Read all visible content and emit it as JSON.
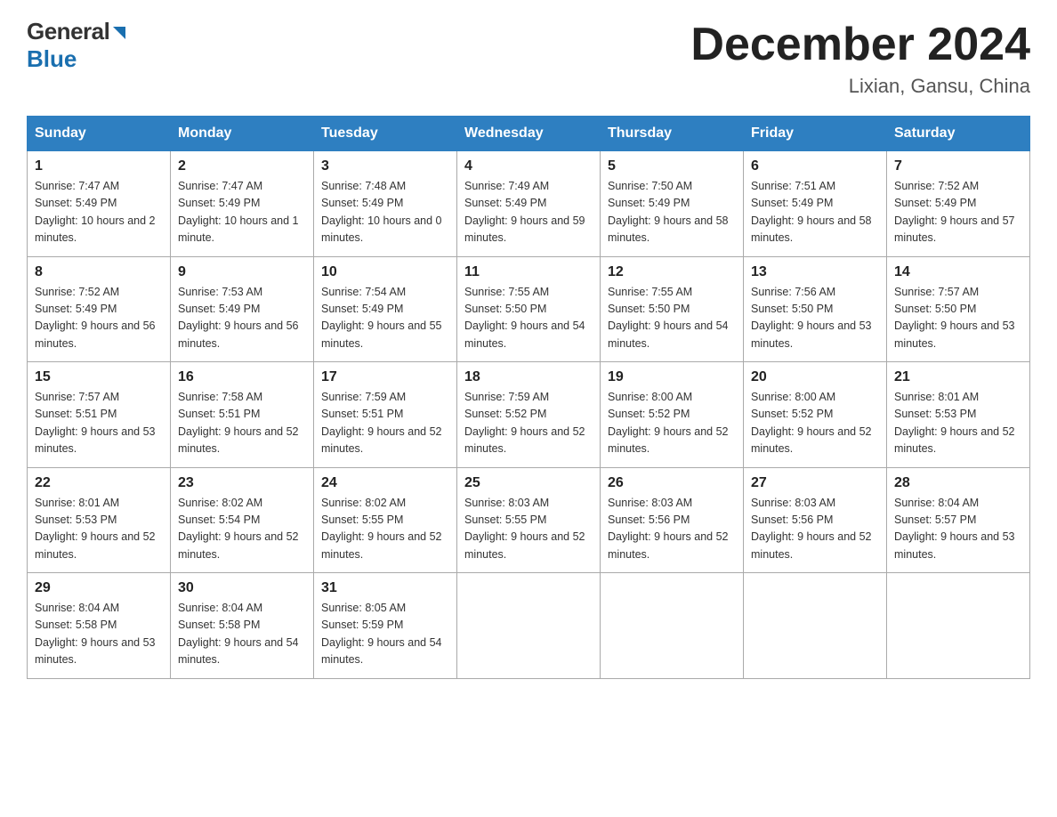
{
  "header": {
    "logo_general": "General",
    "logo_blue": "Blue",
    "month_title": "December 2024",
    "location": "Lixian, Gansu, China"
  },
  "days_of_week": [
    "Sunday",
    "Monday",
    "Tuesday",
    "Wednesday",
    "Thursday",
    "Friday",
    "Saturday"
  ],
  "weeks": [
    [
      {
        "day": "1",
        "sunrise": "7:47 AM",
        "sunset": "5:49 PM",
        "daylight": "10 hours and 2 minutes."
      },
      {
        "day": "2",
        "sunrise": "7:47 AM",
        "sunset": "5:49 PM",
        "daylight": "10 hours and 1 minute."
      },
      {
        "day": "3",
        "sunrise": "7:48 AM",
        "sunset": "5:49 PM",
        "daylight": "10 hours and 0 minutes."
      },
      {
        "day": "4",
        "sunrise": "7:49 AM",
        "sunset": "5:49 PM",
        "daylight": "9 hours and 59 minutes."
      },
      {
        "day": "5",
        "sunrise": "7:50 AM",
        "sunset": "5:49 PM",
        "daylight": "9 hours and 58 minutes."
      },
      {
        "day": "6",
        "sunrise": "7:51 AM",
        "sunset": "5:49 PM",
        "daylight": "9 hours and 58 minutes."
      },
      {
        "day": "7",
        "sunrise": "7:52 AM",
        "sunset": "5:49 PM",
        "daylight": "9 hours and 57 minutes."
      }
    ],
    [
      {
        "day": "8",
        "sunrise": "7:52 AM",
        "sunset": "5:49 PM",
        "daylight": "9 hours and 56 minutes."
      },
      {
        "day": "9",
        "sunrise": "7:53 AM",
        "sunset": "5:49 PM",
        "daylight": "9 hours and 56 minutes."
      },
      {
        "day": "10",
        "sunrise": "7:54 AM",
        "sunset": "5:49 PM",
        "daylight": "9 hours and 55 minutes."
      },
      {
        "day": "11",
        "sunrise": "7:55 AM",
        "sunset": "5:50 PM",
        "daylight": "9 hours and 54 minutes."
      },
      {
        "day": "12",
        "sunrise": "7:55 AM",
        "sunset": "5:50 PM",
        "daylight": "9 hours and 54 minutes."
      },
      {
        "day": "13",
        "sunrise": "7:56 AM",
        "sunset": "5:50 PM",
        "daylight": "9 hours and 53 minutes."
      },
      {
        "day": "14",
        "sunrise": "7:57 AM",
        "sunset": "5:50 PM",
        "daylight": "9 hours and 53 minutes."
      }
    ],
    [
      {
        "day": "15",
        "sunrise": "7:57 AM",
        "sunset": "5:51 PM",
        "daylight": "9 hours and 53 minutes."
      },
      {
        "day": "16",
        "sunrise": "7:58 AM",
        "sunset": "5:51 PM",
        "daylight": "9 hours and 52 minutes."
      },
      {
        "day": "17",
        "sunrise": "7:59 AM",
        "sunset": "5:51 PM",
        "daylight": "9 hours and 52 minutes."
      },
      {
        "day": "18",
        "sunrise": "7:59 AM",
        "sunset": "5:52 PM",
        "daylight": "9 hours and 52 minutes."
      },
      {
        "day": "19",
        "sunrise": "8:00 AM",
        "sunset": "5:52 PM",
        "daylight": "9 hours and 52 minutes."
      },
      {
        "day": "20",
        "sunrise": "8:00 AM",
        "sunset": "5:52 PM",
        "daylight": "9 hours and 52 minutes."
      },
      {
        "day": "21",
        "sunrise": "8:01 AM",
        "sunset": "5:53 PM",
        "daylight": "9 hours and 52 minutes."
      }
    ],
    [
      {
        "day": "22",
        "sunrise": "8:01 AM",
        "sunset": "5:53 PM",
        "daylight": "9 hours and 52 minutes."
      },
      {
        "day": "23",
        "sunrise": "8:02 AM",
        "sunset": "5:54 PM",
        "daylight": "9 hours and 52 minutes."
      },
      {
        "day": "24",
        "sunrise": "8:02 AM",
        "sunset": "5:55 PM",
        "daylight": "9 hours and 52 minutes."
      },
      {
        "day": "25",
        "sunrise": "8:03 AM",
        "sunset": "5:55 PM",
        "daylight": "9 hours and 52 minutes."
      },
      {
        "day": "26",
        "sunrise": "8:03 AM",
        "sunset": "5:56 PM",
        "daylight": "9 hours and 52 minutes."
      },
      {
        "day": "27",
        "sunrise": "8:03 AM",
        "sunset": "5:56 PM",
        "daylight": "9 hours and 52 minutes."
      },
      {
        "day": "28",
        "sunrise": "8:04 AM",
        "sunset": "5:57 PM",
        "daylight": "9 hours and 53 minutes."
      }
    ],
    [
      {
        "day": "29",
        "sunrise": "8:04 AM",
        "sunset": "5:58 PM",
        "daylight": "9 hours and 53 minutes."
      },
      {
        "day": "30",
        "sunrise": "8:04 AM",
        "sunset": "5:58 PM",
        "daylight": "9 hours and 54 minutes."
      },
      {
        "day": "31",
        "sunrise": "8:05 AM",
        "sunset": "5:59 PM",
        "daylight": "9 hours and 54 minutes."
      },
      null,
      null,
      null,
      null
    ]
  ]
}
